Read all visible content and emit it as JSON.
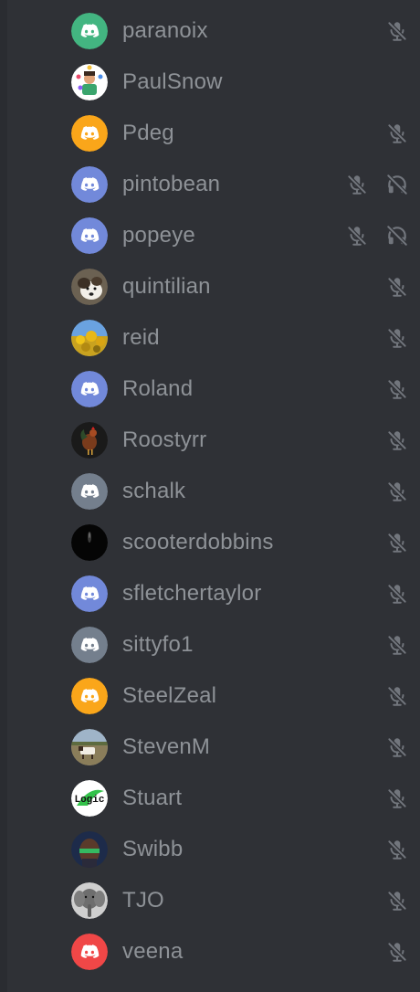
{
  "colors": {
    "background": "#2f3136",
    "name_text": "#8e9297",
    "icon": "#72767d",
    "blurple": "#7289da",
    "green": "#43b581",
    "orange": "#faa61a",
    "grey": "#747f8d",
    "red": "#f04747"
  },
  "members": [
    {
      "name": "paranoix",
      "avatar": "discord-default-green",
      "mic_muted": true,
      "deafened": false
    },
    {
      "name": "PaulSnow",
      "avatar": "juggler-photo",
      "mic_muted": false,
      "deafened": false
    },
    {
      "name": "Pdeg",
      "avatar": "discord-default-orange",
      "mic_muted": true,
      "deafened": false
    },
    {
      "name": "pintobean",
      "avatar": "discord-default-blurple",
      "mic_muted": true,
      "deafened": true
    },
    {
      "name": "popeye",
      "avatar": "discord-default-blurple",
      "mic_muted": true,
      "deafened": true
    },
    {
      "name": "quintilian",
      "avatar": "dog-photo",
      "mic_muted": true,
      "deafened": false
    },
    {
      "name": "reid",
      "avatar": "yellow-flowers-photo",
      "mic_muted": true,
      "deafened": false
    },
    {
      "name": "Roland",
      "avatar": "discord-default-blurple",
      "mic_muted": true,
      "deafened": false
    },
    {
      "name": "Roostyrr",
      "avatar": "rooster-photo",
      "mic_muted": true,
      "deafened": false
    },
    {
      "name": "schalk",
      "avatar": "discord-default-grey",
      "mic_muted": true,
      "deafened": false
    },
    {
      "name": "scooterdobbins",
      "avatar": "dark-photo",
      "mic_muted": true,
      "deafened": false
    },
    {
      "name": "sfletchertaylor",
      "avatar": "discord-default-blurple",
      "mic_muted": true,
      "deafened": false
    },
    {
      "name": "sittyfo1",
      "avatar": "discord-default-grey",
      "mic_muted": true,
      "deafened": false
    },
    {
      "name": "SteelZeal",
      "avatar": "discord-default-orange",
      "mic_muted": true,
      "deafened": false
    },
    {
      "name": "StevenM",
      "avatar": "field-cow-photo",
      "mic_muted": true,
      "deafened": false
    },
    {
      "name": "Stuart",
      "avatar": "logic-logo",
      "mic_muted": true,
      "deafened": false,
      "logo_text": "Logic"
    },
    {
      "name": "Swibb",
      "avatar": "face-photo",
      "mic_muted": true,
      "deafened": false
    },
    {
      "name": "TJO",
      "avatar": "elephant-photo",
      "mic_muted": true,
      "deafened": false
    },
    {
      "name": "veena",
      "avatar": "discord-default-red",
      "mic_muted": true,
      "deafened": false
    }
  ]
}
